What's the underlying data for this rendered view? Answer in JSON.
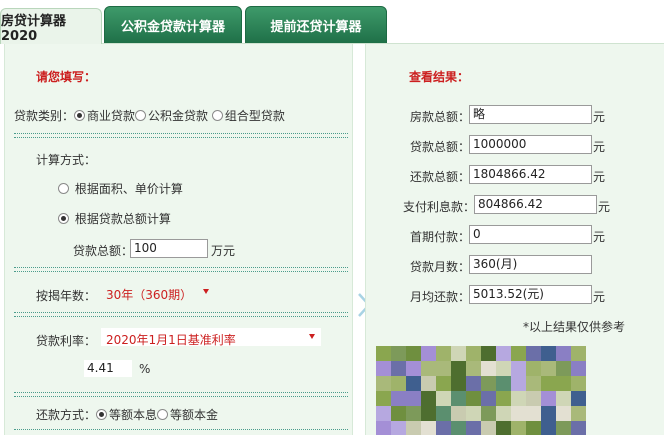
{
  "tabs": [
    "房贷计算器2020",
    "公积金贷款计算器",
    "提前还贷计算器"
  ],
  "left": {
    "heading": "请您填写：",
    "loan_type_label": "贷款类别：",
    "loan_types": [
      "商业贷款",
      "公积金贷款",
      "组合型贷款"
    ],
    "calc_method_label": "计算方式：",
    "calc_methods": [
      "根据面积、单价计算",
      "根据贷款总额计算"
    ],
    "loan_total_label": "贷款总额：",
    "loan_total_value": "100",
    "loan_total_unit": "万元",
    "years_label": "按揭年数：",
    "years_value": "30年（360期）",
    "rate_label": "贷款利率：",
    "rate_value": "2020年1月1日基准利率",
    "rate_number": "4.41",
    "rate_unit": "%",
    "repay_label": "还款方式：",
    "repay_methods": [
      "等额本息",
      "等额本金"
    ]
  },
  "right": {
    "heading": "查看结果：",
    "rows": [
      {
        "label": "房款总额：",
        "value": "略",
        "unit": "元"
      },
      {
        "label": "贷款总额：",
        "value": "1000000",
        "unit": "元"
      },
      {
        "label": "还款总额：",
        "value": "1804866.42",
        "unit": "元"
      },
      {
        "label": "支付利息款：",
        "value": "804866.42",
        "unit": "元"
      },
      {
        "label": "首期付款：",
        "value": "0",
        "unit": "元"
      },
      {
        "label": "贷款月数：",
        "value": "360(月)",
        "unit": ""
      },
      {
        "label": "月均还款：",
        "value": "5013.52(元)",
        "unit": "元"
      }
    ],
    "note": "*以上结果仅供参考"
  },
  "colors": {
    "accent_red": "#cc1f1f",
    "tab_green": "#2a7f55",
    "panel_bg": "#eef7ee"
  }
}
